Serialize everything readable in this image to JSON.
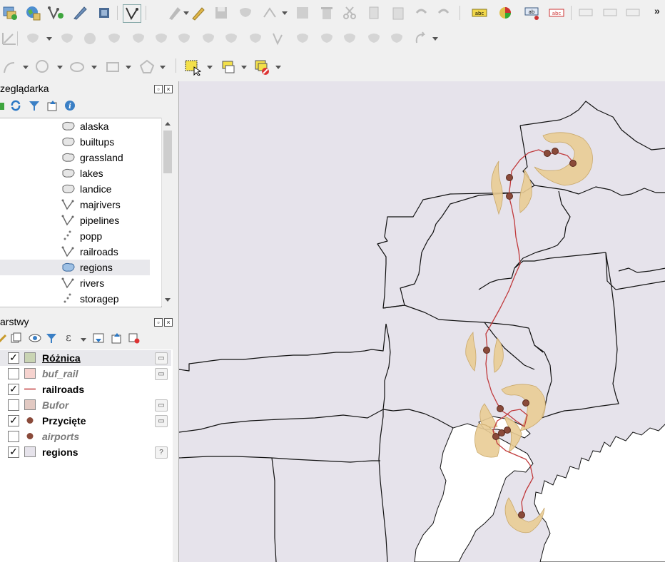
{
  "colors": {
    "region_fill": "#e6e3eb",
    "buffer_fill": "#e9cc95",
    "railroad": "#c0393b",
    "airport": "#8a4a3a",
    "roznica_swatch": "#c9d4b4",
    "buf_rail_swatch": "#f6d3cf",
    "bufor_swatch": "#e2c9c2"
  },
  "toolbars": {
    "row1_icons": [
      "add-layer-icon",
      "globe-plugin-icon",
      "add-vector-icon",
      "digitize-icon",
      "chip-icon",
      "vertex-tool-icon",
      "edit-pencil-icon",
      "save-edits-icon",
      "add-feature-icon",
      "move-feature-icon",
      "node-tool-icon",
      "delete-icon",
      "cut-icon",
      "copy-icon",
      "paste-icon",
      "undo-icon",
      "redo-icon",
      "label-icon",
      "diagram-icon",
      "label-pin-icon",
      "label-highlight-icon",
      "label-move-icon",
      "label-show-icon",
      "label-rotate-icon",
      "overflow-icon"
    ],
    "row2_icons": [
      "add-ring-icon",
      "add-part-icon",
      "fill-ring-icon",
      "delete-ring-icon",
      "delete-part-icon",
      "reshape-icon",
      "offset-icon",
      "split-icon",
      "split-parts-icon",
      "merge-icon",
      "merge-attr-icon",
      "rotate-symbol-icon",
      "simplify-icon"
    ],
    "row3_icons": [
      "trace-icon",
      "circle-icon",
      "ellipse-icon",
      "rectangle-icon",
      "polygon-icon",
      "select-feature-icon",
      "select-by-value-icon",
      "deselect-icon"
    ],
    "overflow_label": "»"
  },
  "browser": {
    "title": "zeglądarka",
    "items": [
      {
        "label": "alaska",
        "kind": "polygon"
      },
      {
        "label": "builtups",
        "kind": "polygon"
      },
      {
        "label": "grassland",
        "kind": "polygon"
      },
      {
        "label": "lakes",
        "kind": "polygon"
      },
      {
        "label": "landice",
        "kind": "polygon"
      },
      {
        "label": "majrivers",
        "kind": "line"
      },
      {
        "label": "pipelines",
        "kind": "line"
      },
      {
        "label": "popp",
        "kind": "point"
      },
      {
        "label": "railroads",
        "kind": "line"
      },
      {
        "label": "regions",
        "kind": "polygon-selected"
      },
      {
        "label": "rivers",
        "kind": "line"
      },
      {
        "label": "storagep",
        "kind": "point"
      }
    ]
  },
  "layers_panel": {
    "title": "arstwy",
    "layers": [
      {
        "name": "Różnica",
        "checked": true,
        "symbol": "square",
        "color": "#c9d4b4",
        "badge": "▭",
        "style": "active"
      },
      {
        "name": "buf_rail",
        "checked": false,
        "symbol": "square",
        "color": "#f6d3cf",
        "badge": "▭",
        "style": "off"
      },
      {
        "name": "railroads",
        "checked": true,
        "symbol": "line",
        "color": "#c0393b",
        "badge": "",
        "style": "on"
      },
      {
        "name": "Bufor",
        "checked": false,
        "symbol": "square",
        "color": "#e2c9c2",
        "badge": "▭",
        "style": "off"
      },
      {
        "name": "Przycięte",
        "checked": true,
        "symbol": "dot",
        "color": "#8a4a3a",
        "badge": "▭",
        "style": "on"
      },
      {
        "name": "airports",
        "checked": false,
        "symbol": "dot",
        "color": "#8a4a3a",
        "badge": "",
        "style": "off"
      },
      {
        "name": "regions",
        "checked": true,
        "symbol": "square",
        "color": "#e6e3eb",
        "badge": "?",
        "style": "on"
      }
    ],
    "check_glyph": "✓"
  }
}
